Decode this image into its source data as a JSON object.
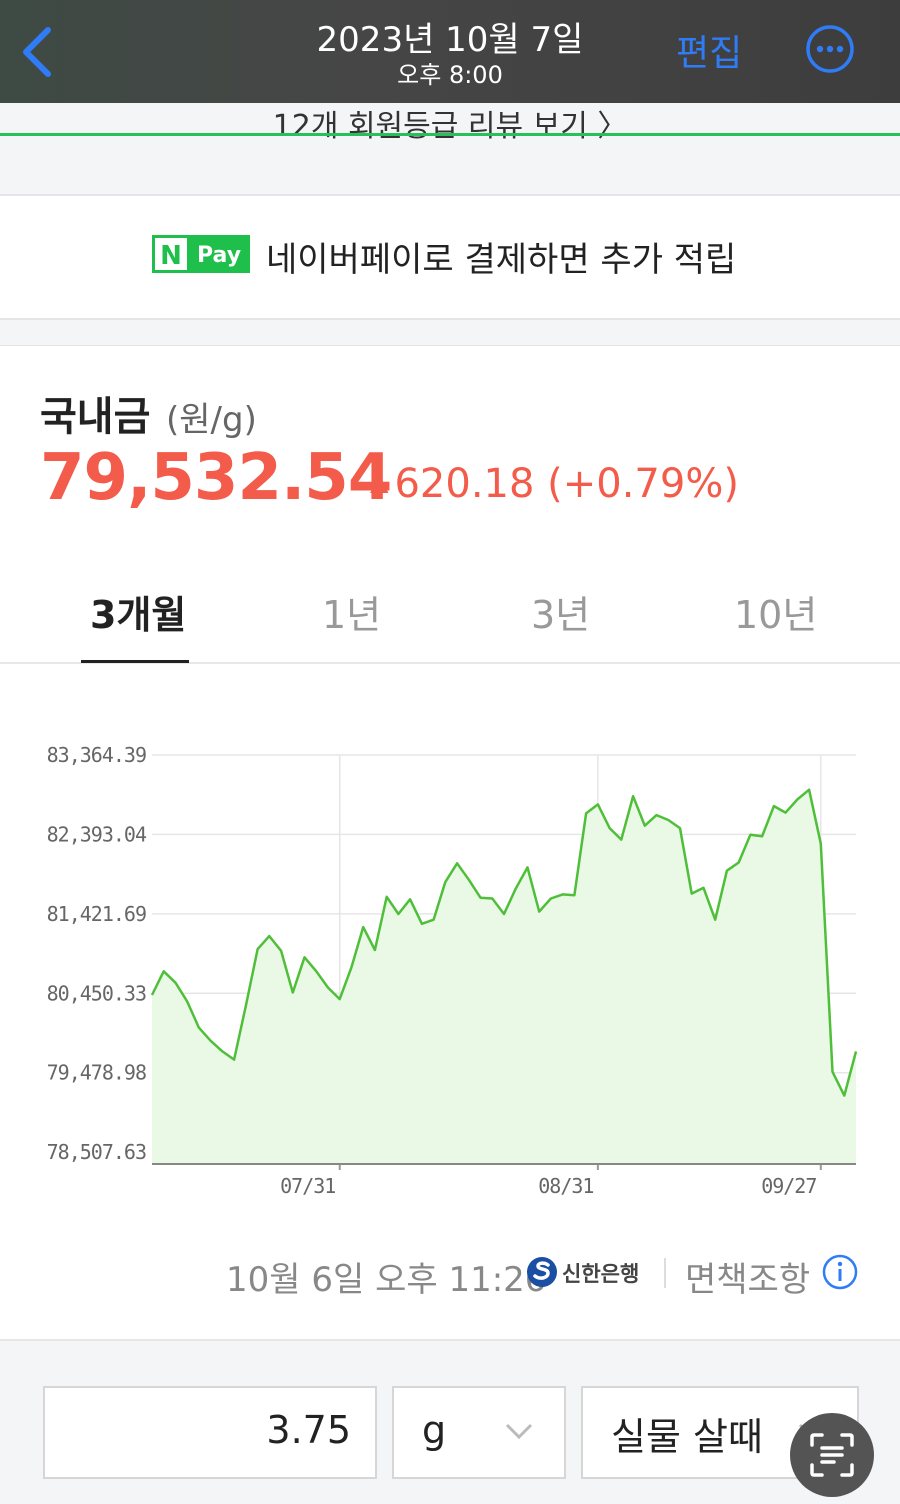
{
  "topbar": {
    "date": "2023년 10월 7일",
    "time": "오후 8:00",
    "edit": "편집",
    "back_icon": "chevron-left-icon",
    "more_icon": "ellipsis-circle-icon"
  },
  "review_link": {
    "text": "12개 회원등급 리뷰 보기 〉"
  },
  "npay": {
    "logo_n": "N",
    "logo_pay": "Pay",
    "text": "네이버페이로 결제하면 추가 적립"
  },
  "price": {
    "title": "국내금",
    "unit": "(원/g)",
    "value": "79,532.54",
    "change": "620.18 (+0.79%)",
    "direction": "up",
    "color": "#f35b4a"
  },
  "tabs": [
    {
      "label": "3개월",
      "active": true
    },
    {
      "label": "1년",
      "active": false
    },
    {
      "label": "3년",
      "active": false
    },
    {
      "label": "10년",
      "active": false
    }
  ],
  "chart_data": {
    "type": "area",
    "title": "",
    "xlabel": "",
    "ylabel": "",
    "y_ticks": [
      "83,364.39",
      "82,393.04",
      "81,421.69",
      "80,450.33",
      "79,478.98",
      "78,507.63"
    ],
    "x_ticks": [
      "07/31",
      "08/31",
      "09/27"
    ],
    "ylim": [
      78363,
      83364.39
    ],
    "grid": true,
    "line_color": "#4fbf3a",
    "fill_color": "#e9f9e6",
    "series": [
      {
        "values": [
          80430,
          80720,
          80580,
          80350,
          80030,
          79870,
          79740,
          79640,
          80300,
          80990,
          81150,
          80970,
          80460,
          80890,
          80720,
          80520,
          80380,
          80770,
          81260,
          80980,
          81630,
          81420,
          81600,
          81300,
          81350,
          81810,
          82040,
          81840,
          81620,
          81610,
          81420,
          81730,
          81990,
          81450,
          81610,
          81660,
          81650,
          82650,
          82760,
          82470,
          82330,
          82860,
          82500,
          82630,
          82570,
          82470,
          81670,
          81740,
          81350,
          81950,
          82050,
          82390,
          82370,
          82740,
          82660,
          82820,
          82940,
          82280,
          79490,
          79200,
          79740
        ]
      }
    ]
  },
  "footer": {
    "datetime": "10월 6일 오후 11:26",
    "bank": "신한은행",
    "disclaimer": "면책조항",
    "info_icon": "info-circle-icon"
  },
  "calc": {
    "quantity": "3.75",
    "unit": "g",
    "type": "실물 살때",
    "chevron_icon": "chevron-down-icon"
  },
  "scan_icon": "text-scan-icon"
}
